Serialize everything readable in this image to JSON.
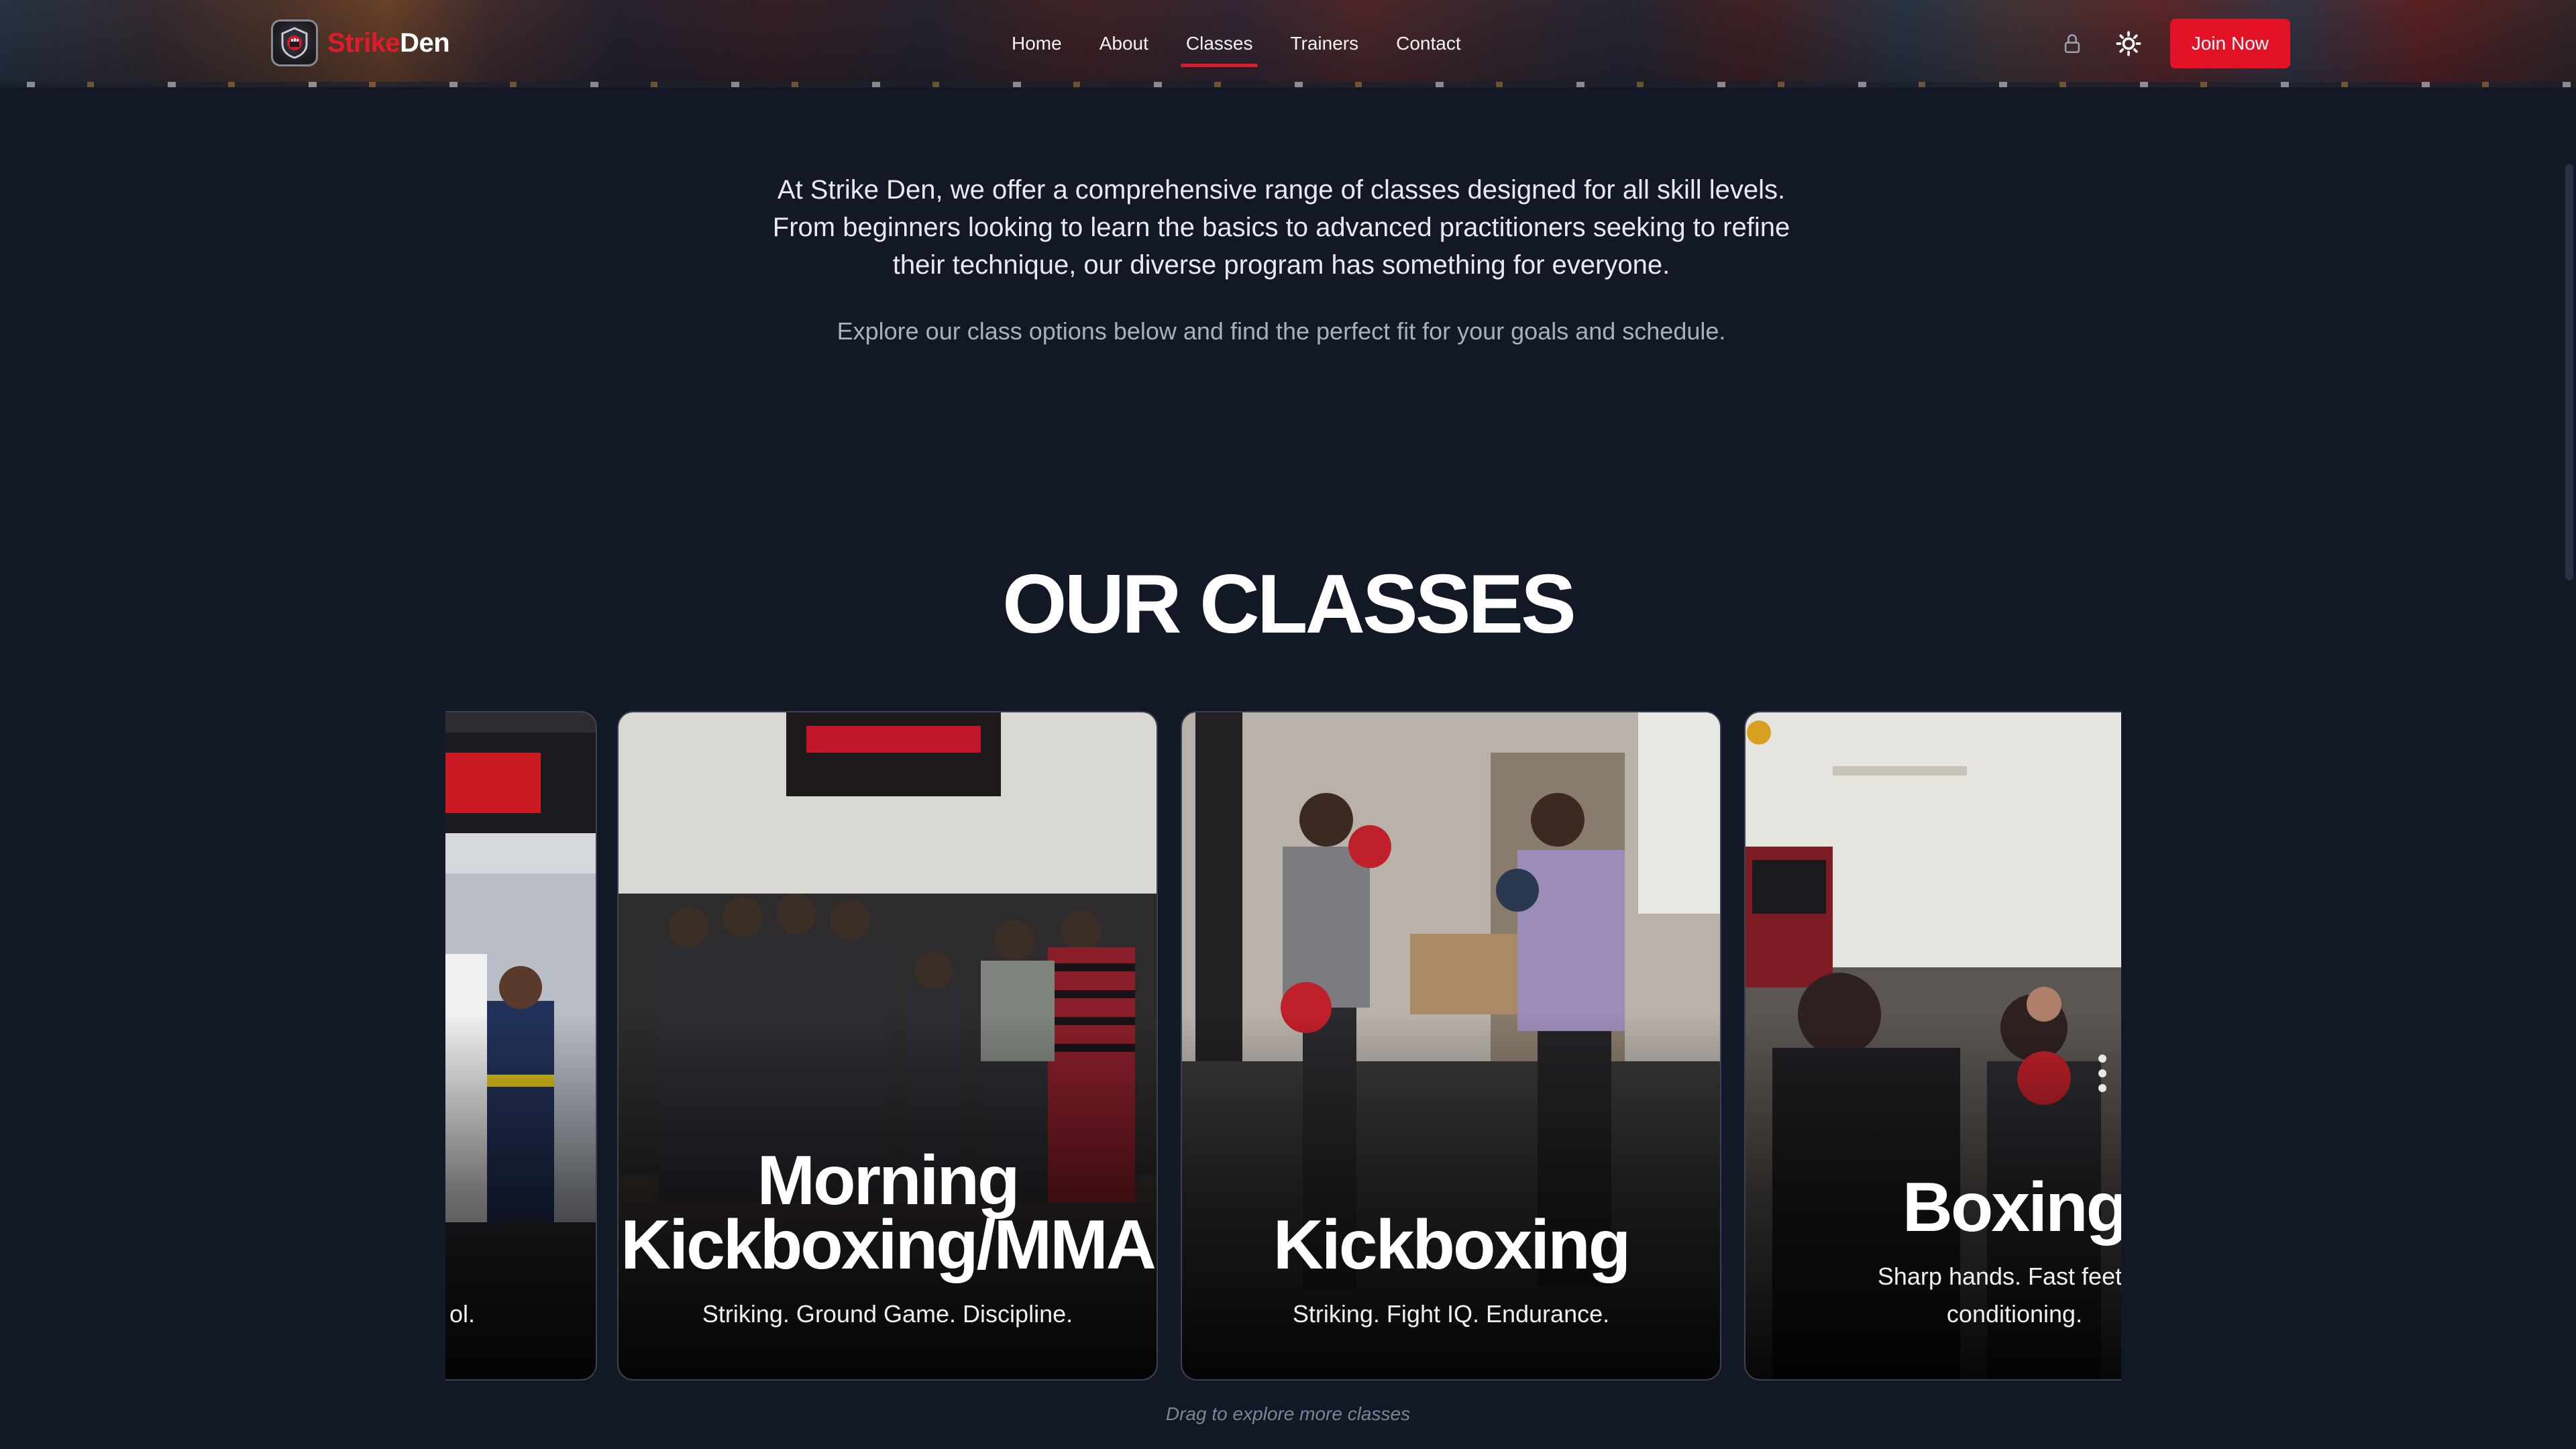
{
  "brand": {
    "name_part1": "Strike",
    "name_part2": "Den",
    "logo_icon": "fist-shield-icon"
  },
  "nav": {
    "links": [
      {
        "label": "Home",
        "active": false
      },
      {
        "label": "About",
        "active": false
      },
      {
        "label": "Classes",
        "active": true
      },
      {
        "label": "Trainers",
        "active": false
      },
      {
        "label": "Contact",
        "active": false
      }
    ],
    "lock_icon": "lock-icon",
    "theme_icon": "sun-icon",
    "join_label": "Join Now"
  },
  "colors": {
    "accent": "#e41227",
    "background": "#121826",
    "heading": "#ffffff"
  },
  "intro": {
    "paragraph1": "At Strike Den, we offer a comprehensive range of classes designed for all skill levels. From beginners looking to learn the basics to advanced practitioners seeking to refine their technique, our diverse program has something for everyone.",
    "paragraph2": "Explore our class options below and find the perfect fit for your goals and schedule."
  },
  "section": {
    "title": "OUR CLASSES"
  },
  "classes": [
    {
      "title": "",
      "subtitle": "ol."
    },
    {
      "title_line1": "Morning",
      "title_line2": "Kickboxing/MMA",
      "subtitle": "Striking. Ground Game. Discipline."
    },
    {
      "title": "Kickboxing",
      "subtitle": "Striking. Fight IQ. Endurance."
    },
    {
      "title": "Boxing",
      "subtitle_line1": "Sharp hands. Fast feet. S",
      "subtitle_line2": "conditioning."
    }
  ],
  "carousel": {
    "hint": "Drag to explore more classes"
  }
}
